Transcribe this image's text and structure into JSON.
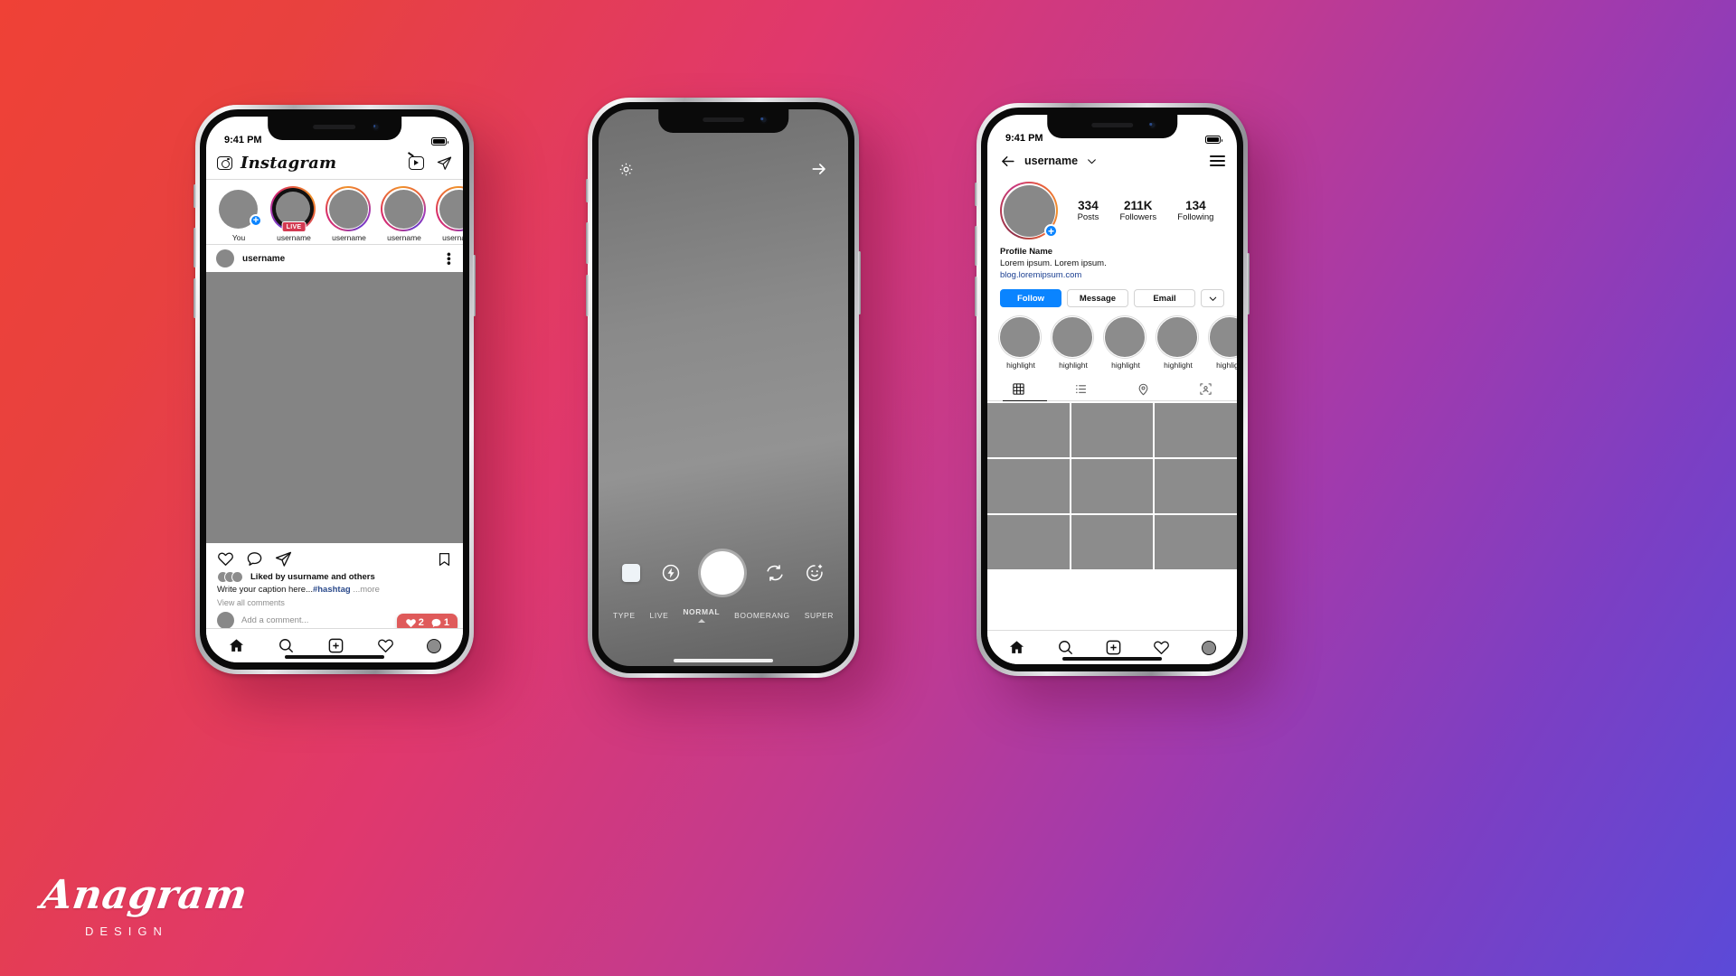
{
  "watermark": {
    "brand": "Anagram",
    "sub": "Design"
  },
  "theme": {
    "accent_blue": "#0a84ff",
    "badge_red": "#df5a5a",
    "live_red": "#d33a52",
    "link_blue": "#2b4a8b",
    "placeholder_gray": "#8e8e8e",
    "image_gray": "#848484",
    "background_gradient": "linear-gradient(120deg,#ef4136,#e0386d,#a13aad,#5b4ad8)"
  },
  "phone_feed": {
    "status": {
      "time": "9:41 PM",
      "battery_icon": "battery-icon"
    },
    "header": {
      "camera_icon": "camera-icon",
      "logo_text": "Instagram",
      "igtv_icon": "igtv-icon",
      "share_icon": "paper-plane-icon"
    },
    "stories": [
      {
        "label": "You",
        "ring": "none",
        "badge": "plus",
        "live": false
      },
      {
        "label": "username",
        "ring": "gradient",
        "badge": "none",
        "live": true
      },
      {
        "label": "username",
        "ring": "gradient",
        "badge": "none",
        "live": false
      },
      {
        "label": "username",
        "ring": "gradient",
        "badge": "none",
        "live": false
      },
      {
        "label": "username",
        "ring": "gradient",
        "badge": "none",
        "live": false
      }
    ],
    "story_live_label": "LIVE",
    "post": {
      "author": "username",
      "more_icon": "kebab-menu-icon",
      "actions": {
        "like_icon": "heart-icon",
        "comment_icon": "comment-bubble-icon",
        "share_icon": "paper-plane-icon",
        "save_icon": "bookmark-icon"
      },
      "likes_text": "Liked by usurname and others",
      "caption_text": "Write your caption here...",
      "caption_hashtag": "#hashtag",
      "caption_more": "...more",
      "view_comments": "View all comments",
      "comment_placeholder": "Add a comment..."
    },
    "notification_bubble": {
      "likes_icon": "heart-filled-icon",
      "likes_count": "2",
      "comments_icon": "comment-filled-icon",
      "comments_count": "1"
    },
    "tabbar": {
      "home_icon": "home-icon",
      "search_icon": "search-icon",
      "add_icon": "plus-square-icon",
      "activity_icon": "heart-icon",
      "profile_icon": "avatar-icon"
    }
  },
  "phone_camera": {
    "settings_icon": "gear-icon",
    "next_icon": "arrow-right-icon",
    "gallery_icon": "gallery-thumbnail-icon",
    "flash_icon": "flash-icon",
    "shutter_icon": "shutter-button",
    "flip_icon": "switch-camera-icon",
    "effects_icon": "smiley-effects-icon",
    "modes": [
      "TYPE",
      "LIVE",
      "NORMAL",
      "BOOMERANG",
      "SUPER"
    ],
    "active_mode": "NORMAL"
  },
  "phone_profile": {
    "status": {
      "time": "9:41 PM",
      "battery_icon": "battery-icon"
    },
    "header": {
      "back_icon": "arrow-left-icon",
      "username": "username",
      "chevron_icon": "chevron-down-icon",
      "menu_icon": "hamburger-menu-icon"
    },
    "avatar_badge": "plus",
    "stats": [
      {
        "value": "334",
        "label": "Posts"
      },
      {
        "value": "211K",
        "label": "Followers"
      },
      {
        "value": "134",
        "label": "Following"
      }
    ],
    "bio": {
      "name": "Profile Name",
      "description": "Lorem ipsum. Lorem ipsum.",
      "link": "blog.loremipsum.com"
    },
    "buttons": {
      "follow": "Follow",
      "message": "Message",
      "email": "Email",
      "more_icon": "chevron-down-icon"
    },
    "highlights": [
      {
        "label": "highlight"
      },
      {
        "label": "highlight"
      },
      {
        "label": "highlight"
      },
      {
        "label": "highlight"
      },
      {
        "label": "highlight"
      }
    ],
    "tabs": [
      {
        "icon": "grid-icon",
        "active": true
      },
      {
        "icon": "list-icon",
        "active": false
      },
      {
        "icon": "location-pin-icon",
        "active": false
      },
      {
        "icon": "tagged-person-icon",
        "active": false
      }
    ],
    "tabbar": {
      "home_icon": "home-icon",
      "search_icon": "search-icon",
      "add_icon": "plus-square-icon",
      "activity_icon": "heart-icon",
      "profile_icon": "avatar-icon"
    }
  }
}
